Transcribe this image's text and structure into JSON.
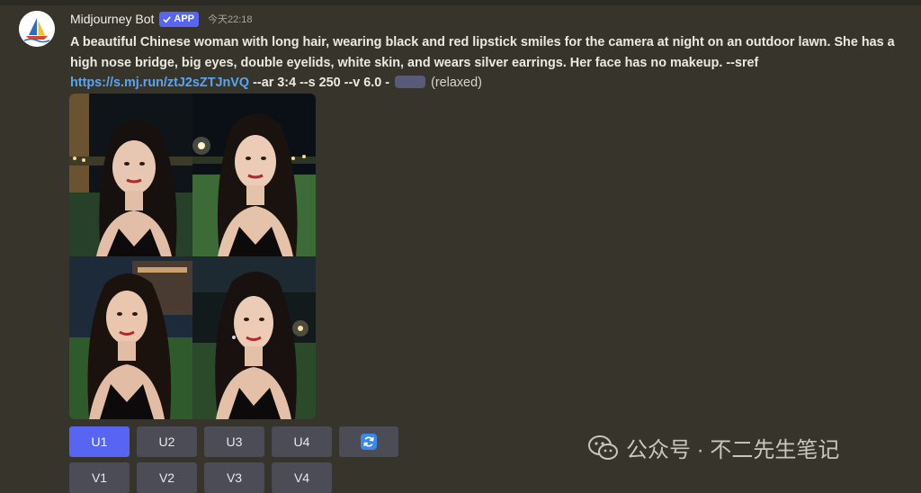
{
  "bot": {
    "name": "Midjourney Bot",
    "badge": "APP",
    "timestamp": "今天22:18"
  },
  "message": {
    "prompt": "A beautiful Chinese woman with long hair, wearing black and red lipstick smiles for the camera at night on an outdoor lawn. She has a high nose bridge, big eyes, double eyelids, white skin, and wears silver earrings. Her face has no makeup. --sref",
    "link": "https://s.mj.run/ztJ2sZTJnVQ",
    "params": "--ar 3:4 --s 250 --v 6.0 -",
    "mode": "(relaxed)"
  },
  "image_grid": {
    "alt": [
      "image-1",
      "image-2",
      "image-3",
      "image-4"
    ]
  },
  "buttons": {
    "row1": [
      "U1",
      "U2",
      "U3",
      "U4"
    ],
    "refresh_icon": "refresh-icon",
    "row2": [
      "V1",
      "V2",
      "V3",
      "V4"
    ]
  },
  "watermark": {
    "text": "公众号 · 不二先生笔记",
    "icon": "wechat-icon"
  },
  "colors": {
    "background": "#36342b",
    "accent": "#5865f2",
    "link": "#5aa4f0",
    "button": "#4b4c55"
  }
}
